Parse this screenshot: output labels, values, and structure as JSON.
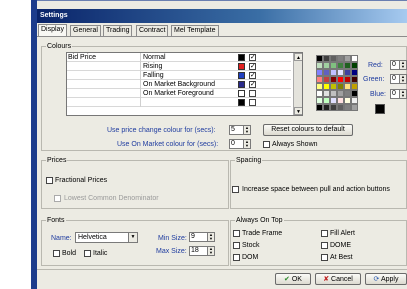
{
  "window": {
    "title": "Settings"
  },
  "tabs": [
    {
      "label": "Display",
      "active": true
    },
    {
      "label": "General"
    },
    {
      "label": "Trading"
    },
    {
      "label": "Contract"
    },
    {
      "label": "Mel Template"
    }
  ],
  "colours": {
    "title": "Colours",
    "rows": [
      {
        "name": "Bid Price",
        "state": "Normal",
        "swatch": "#000000",
        "checked": true
      },
      {
        "name": "",
        "state": "Rising",
        "swatch": "#e02020",
        "checked": true
      },
      {
        "name": "",
        "state": "Falling",
        "swatch": "#2040c0",
        "checked": true
      },
      {
        "name": "",
        "state": "On Market Background",
        "swatch": "#2a2a8a",
        "checked": true
      },
      {
        "name": "",
        "state": "On Market Foreground",
        "swatch": "#ffffff",
        "checked": false
      },
      {
        "name": "",
        "state": "",
        "swatch": "#000000",
        "checked": false
      }
    ],
    "palette": [
      "#000000",
      "#404040",
      "#606060",
      "#808080",
      "#a0a0a0",
      "#ffffff",
      "#c0e0c0",
      "#a0d0a0",
      "#80c080",
      "#408040",
      "#206020",
      "#004000",
      "#8080ff",
      "#6060c0",
      "#c0c0ff",
      "#e0e0ff",
      "#4040a0",
      "#000080",
      "#ff8080",
      "#c04040",
      "#800000",
      "#ff0000",
      "#c00000",
      "#400000",
      "#ffff80",
      "#ffff00",
      "#c0c000",
      "#808000",
      "#ffe080",
      "#c0a000",
      "#ffffff",
      "#e0e0e0",
      "#c0c0c0",
      "#a0a0a0",
      "#808080",
      "#000000",
      "#e0ffe0",
      "#c0ffc0",
      "#e0e0ff",
      "#ffe0e0",
      "#ffffe0",
      "#f0f0f0",
      "#000000",
      "#202020",
      "#404040",
      "#606060",
      "#808080",
      "#a0a0a0"
    ],
    "red_label": "Red:",
    "red_value": "0",
    "green_label": "Green:",
    "green_value": "0",
    "blue_label": "Blue:",
    "blue_value": "0",
    "preview_color": "#000000",
    "price_change_label": "Use price change colour for (secs):",
    "price_change_value": "5",
    "on_market_label": "Use On Market colour for (secs):",
    "on_market_value": "0",
    "reset_button": "Reset colours to default",
    "always_shown_label": "Always Shown"
  },
  "prices": {
    "title": "Prices",
    "fractional_label": "Fractional Prices",
    "lcd_label": "Lowest Common Denominator"
  },
  "spacing": {
    "title": "Spacing",
    "increase_label": "Increase space between pull and action buttons"
  },
  "fonts": {
    "title": "Fonts",
    "name_label": "Name:",
    "name_value": "Helvetica",
    "min_size_label": "Min Size:",
    "min_size_value": "9",
    "max_size_label": "Max Size:",
    "max_size_value": "18",
    "bold_label": "Bold",
    "italic_label": "Italic"
  },
  "always_on_top": {
    "title": "Always On Top",
    "items": [
      "Trade Frame",
      "Fill Alert",
      "Stock",
      "DOME",
      "DOM",
      "At Best"
    ]
  },
  "buttons": {
    "ok": "OK",
    "cancel": "Cancel",
    "apply": "Apply"
  }
}
